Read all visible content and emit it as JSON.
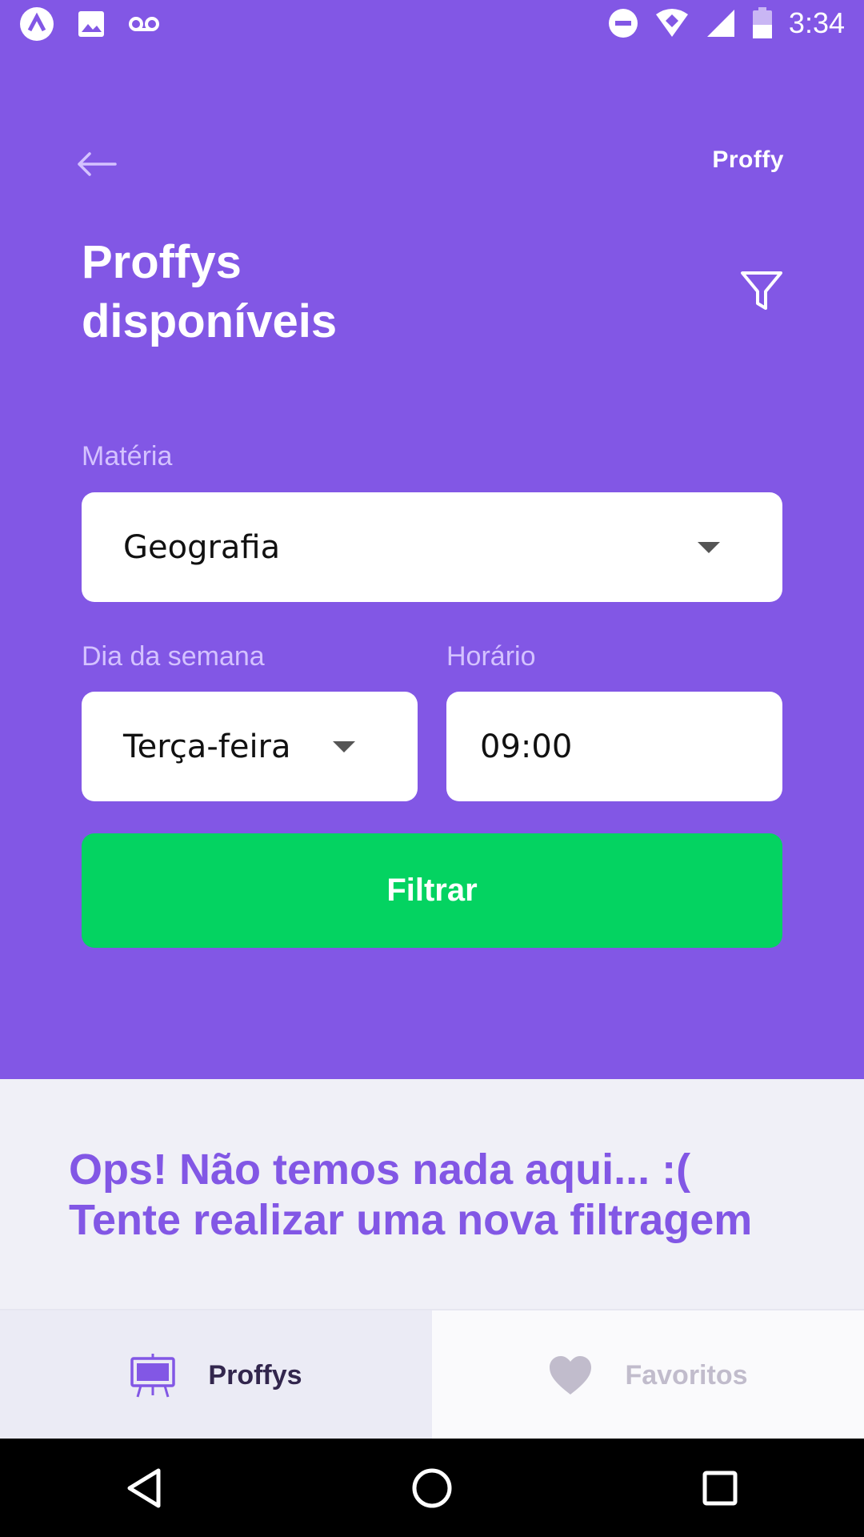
{
  "status_bar": {
    "time": "3:34",
    "battery_level": "44",
    "icons": [
      "app-icon",
      "image-icon",
      "voicemail-icon",
      "do-not-disturb-icon",
      "wifi-icon",
      "signal-icon",
      "battery-icon"
    ]
  },
  "header": {
    "logo": "Proffy",
    "title_line1": "Proffys",
    "title_line2": "disponíveis"
  },
  "filters": {
    "subject_label": "Matéria",
    "subject_value": "Geografia",
    "weekday_label": "Dia da semana",
    "weekday_value": "Terça-feira",
    "time_label": "Horário",
    "time_value": "09:00",
    "submit_label": "Filtrar"
  },
  "empty_state": {
    "line1": "Ops! Não temos nada aqui... :(",
    "line2": "Tente realizar uma nova filtragem"
  },
  "tabs": [
    {
      "label": "Proffys",
      "icon": "easel-icon",
      "active": true
    },
    {
      "label": "Favoritos",
      "icon": "heart-icon",
      "active": false
    }
  ],
  "colors": {
    "primary": "#8257E5",
    "success": "#04D361",
    "background": "#F0F0F7",
    "tab_active_text": "#32264D",
    "tab_inactive_text": "#C1BCCC"
  }
}
